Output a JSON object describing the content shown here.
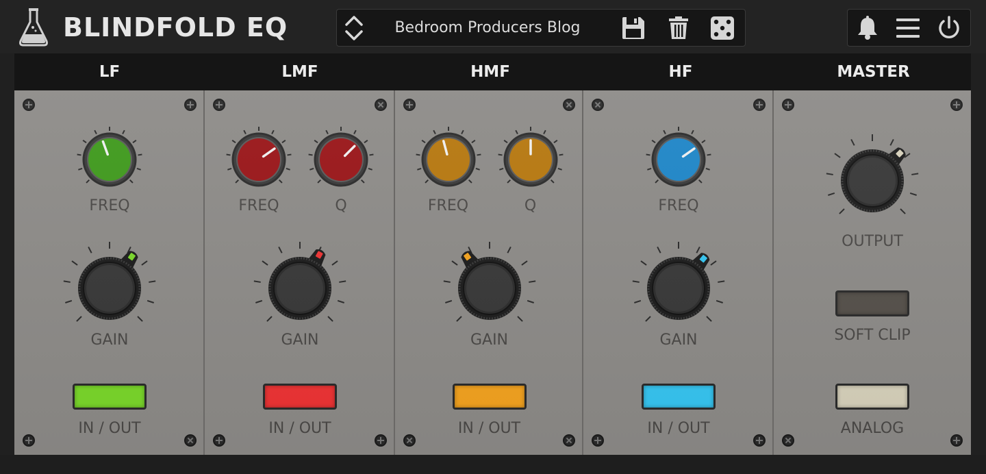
{
  "app": {
    "title": "BLINDFOLD EQ"
  },
  "preset": {
    "name": "Bedroom Producers Blog"
  },
  "icons": {
    "logo": "flask-icon",
    "preset_nav": "up-down-arrows-icon",
    "save": "floppy-disk-icon",
    "delete": "trash-icon",
    "random": "dice-icon",
    "notify": "bell-icon",
    "menu": "hamburger-menu-icon",
    "power": "power-icon"
  },
  "sections": [
    {
      "id": "lf",
      "title": "LF",
      "color": "#3f9a1c",
      "led": "#7ad82a",
      "knobs": [
        {
          "label": "FREQ"
        }
      ],
      "gain_label": "GAIN",
      "button_label": "IN / OUT"
    },
    {
      "id": "lmf",
      "title": "LMF",
      "color": "#9a1518",
      "led": "#ef3334",
      "knobs": [
        {
          "label": "FREQ"
        },
        {
          "label": "Q"
        }
      ],
      "gain_label": "GAIN",
      "button_label": "IN / OUT"
    },
    {
      "id": "hmf",
      "title": "HMF",
      "color": "#b7780f",
      "led": "#f4a31f",
      "knobs": [
        {
          "label": "FREQ"
        },
        {
          "label": "Q"
        }
      ],
      "gain_label": "GAIN",
      "button_label": "IN / OUT"
    },
    {
      "id": "hf",
      "title": "HF",
      "color": "#1e86c8",
      "led": "#36c6f2",
      "knobs": [
        {
          "label": "FREQ"
        }
      ],
      "gain_label": "GAIN",
      "button_label": "IN / OUT"
    }
  ],
  "master": {
    "title": "MASTER",
    "output_label": "OUTPUT",
    "soft_clip_label": "SOFT CLIP",
    "analog_label": "ANALOG",
    "soft_clip_color": "#55504a",
    "analog_color": "#d8d2bc"
  },
  "colors": {
    "panel": "#8d8b88",
    "header_bg": "#232323",
    "text_dark": "#4a4846",
    "text_light": "#e6e6e6"
  }
}
